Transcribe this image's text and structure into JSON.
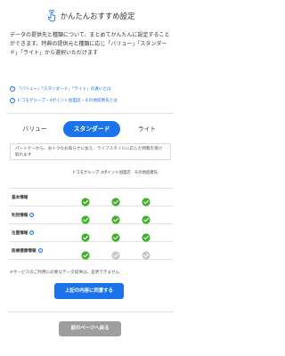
{
  "header": {
    "title": "かんたんおすすめ設定",
    "icon": "tap-hand-icon"
  },
  "intro": {
    "text": "データの提供先と種類について、まとめてかんたんに設定することができます。特典の提供元と種類に応じ「バリュー」「スタンダード」「ライト」から選択いただけます"
  },
  "links": [
    {
      "label": "「バリュー」「スタンダード」「ライト」の違いとは",
      "icon": "question-circle-icon"
    },
    {
      "label": "ドコモグループ・dポイント加盟店・その他提携先とは",
      "icon": "question-circle-icon"
    }
  ],
  "tabs": [
    {
      "label": "バリュー",
      "selected": false
    },
    {
      "label": "スタンダード",
      "selected": true
    },
    {
      "label": "ライト",
      "selected": false
    }
  ],
  "description": "パートナーから、おトクなお知らせに加え、ライフスタイルに応じた特典を受け取れます",
  "table": {
    "columns": [
      "ドコモグループ",
      "dポイント加盟店",
      "その他提携先"
    ],
    "rows": [
      {
        "label": "基本情報",
        "help": false,
        "values": [
          true,
          true,
          true
        ]
      },
      {
        "label": "利用情報",
        "help": true,
        "values": [
          true,
          true,
          true
        ]
      },
      {
        "label": "位置情報",
        "help": true,
        "values": [
          true,
          true,
          true
        ]
      },
      {
        "label": "医療健康情報",
        "help": true,
        "values": [
          true,
          false,
          false
        ]
      }
    ]
  },
  "note": "※サービスのご利用に必要なデータ提供は、変更できません",
  "buttons": {
    "agree": "上記の内容に同意する",
    "back": "前のページへ戻る"
  },
  "colors": {
    "accent": "#1a73e8",
    "check_on": "#43b02a",
    "check_off": "#c8c8c8",
    "back_button": "#9e9e9e"
  }
}
